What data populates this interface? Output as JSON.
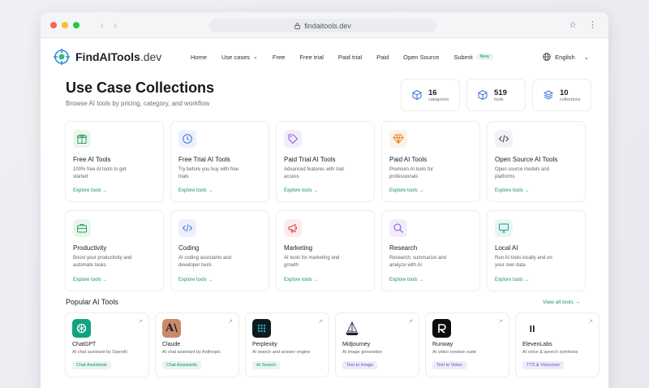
{
  "browser": {
    "url": "findaitools.dev"
  },
  "brand": {
    "name": "FindAITools",
    "suffix": ".dev"
  },
  "nav": {
    "items": [
      "Home",
      "Use cases",
      "Free",
      "Free trial",
      "Paid trial",
      "Paid",
      "Open Source",
      "Submit"
    ],
    "new_badge": "New",
    "language": "English"
  },
  "hero": {
    "title": "Use Case Collections",
    "subtitle": "Browse AI tools by pricing, category, and workflow"
  },
  "stats": [
    {
      "value": "16",
      "label": "categories",
      "icon": "cube-icon"
    },
    {
      "value": "519",
      "label": "tools",
      "icon": "box-icon"
    },
    {
      "value": "10",
      "label": "collections",
      "icon": "layers-icon"
    }
  ],
  "collections": [
    {
      "title": "Free AI Tools",
      "desc": "100% free AI tools to get started",
      "link": "Explore tools →",
      "icon": "gift-icon",
      "color": "#2f9e62",
      "bg": "#e8f7ee"
    },
    {
      "title": "Free Trial AI Tools",
      "desc": "Try before you buy with free trials",
      "link": "Explore tools →",
      "icon": "clock-icon",
      "color": "#3d6fd6",
      "bg": "#ebf1fc"
    },
    {
      "title": "Paid Trial AI Tools",
      "desc": "Advanced features with trial access",
      "link": "Explore tools →",
      "icon": "tag-icon",
      "color": "#8a5ad6",
      "bg": "#f2ecfc"
    },
    {
      "title": "Paid AI Tools",
      "desc": "Premium AI tools for professionals",
      "link": "Explore tools →",
      "icon": "diamond-icon",
      "color": "#e08a2c",
      "bg": "#fdf2e6"
    },
    {
      "title": "Open Source AI Tools",
      "desc": "Open source models and platforms",
      "link": "Explore tools →",
      "icon": "code-icon",
      "color": "#3b3f47",
      "bg": "#f1f2f4"
    }
  ],
  "categories": [
    {
      "title": "Productivity",
      "desc": "Boost your productivity and automate tasks",
      "link": "Explore tools →",
      "icon": "briefcase-icon",
      "color": "#2f9e62",
      "bg": "#e8f7ee"
    },
    {
      "title": "Coding",
      "desc": "AI coding assistants and developer tools",
      "link": "Explore tools →",
      "icon": "code-icon",
      "color": "#3d6fd6",
      "bg": "#ebf1fc"
    },
    {
      "title": "Marketing",
      "desc": "AI tools for marketing and growth",
      "link": "Explore tools →",
      "icon": "megaphone-icon",
      "color": "#e0484d",
      "bg": "#fdecec"
    },
    {
      "title": "Research",
      "desc": "Research, summarize and analyze with AI",
      "link": "Explore tools →",
      "icon": "search-icon",
      "color": "#8a5ad6",
      "bg": "#f2ecfc"
    },
    {
      "title": "Local AI",
      "desc": "Run AI tools locally and on your own data",
      "link": "Explore tools →",
      "icon": "monitor-icon",
      "color": "#1e9c94",
      "bg": "#e5f6f4"
    }
  ],
  "popular": {
    "title": "Popular AI Tools",
    "view_all": "View all tools →",
    "tools": [
      {
        "name": "ChatGPT",
        "desc": "AI chat assistant by OpenAI",
        "tag": "Chat Assistants",
        "tag_style": "green",
        "logo_bg": "#10a37f",
        "logo_fg": "#ffffff",
        "icon": "chatgpt-logo-icon"
      },
      {
        "name": "Claude",
        "desc": "AI chat assistant by Anthropic",
        "tag": "Chat Assistants",
        "tag_style": "green",
        "logo_bg": "#c98a68",
        "logo_fg": "#1b1f27",
        "icon": "claude-logo-icon"
      },
      {
        "name": "Perplexity",
        "desc": "AI search and answer engine",
        "tag": "AI Search",
        "tag_style": "green",
        "logo_bg": "#0f1a1f",
        "logo_fg": "#20b8cd",
        "icon": "perplexity-logo-icon"
      },
      {
        "name": "Midjourney",
        "desc": "AI image generation",
        "tag": "Text to Image",
        "tag_style": "purple",
        "logo_bg": "#ffffff",
        "logo_fg": "#1b1f27",
        "icon": "midjourney-logo-icon"
      },
      {
        "name": "Runway",
        "desc": "AI video creation suite",
        "tag": "Text to Video",
        "tag_style": "purple",
        "logo_bg": "#0d0d0d",
        "logo_fg": "#ffffff",
        "icon": "runway-logo-icon"
      },
      {
        "name": "ElevenLabs",
        "desc": "AI voice & speech synthesis",
        "tag": "TTS & Voiceover",
        "tag_style": "purple",
        "logo_bg": "#ffffff",
        "logo_fg": "#0d0d0d",
        "icon": "elevenlabs-logo-icon"
      }
    ]
  }
}
